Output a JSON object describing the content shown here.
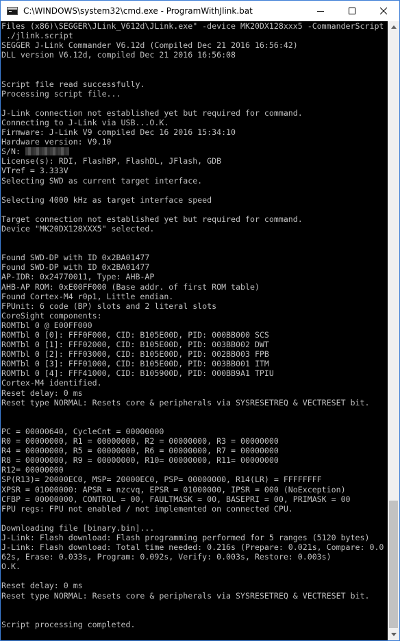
{
  "window": {
    "title": "C:\\WINDOWS\\system32\\cmd.exe - ProgramWithJlink.bat",
    "icon": "cmd-icon",
    "controls": {
      "minimize": "minimize-icon",
      "maximize": "maximize-icon",
      "close": "close-icon"
    }
  },
  "console": {
    "lines": [
      "Files (x86)\\SEGGER\\JLink_V612d\\JLink.exe\" -device MK20DX128xxx5 -CommanderScript",
      " ./jlink.script",
      "SEGGER J-Link Commander V6.12d (Compiled Dec 21 2016 16:56:42)",
      "DLL version V6.12d, compiled Dec 21 2016 16:56:08",
      "",
      "",
      "Script file read successfully.",
      "Processing script file...",
      "",
      "J-Link connection not established yet but required for command.",
      "Connecting to J-Link via USB...O.K.",
      "Firmware: J-Link V9 compiled Dec 16 2016 15:34:10",
      "Hardware version: V9.10",
      "S/N: ",
      "License(s): RDI, FlashBP, FlashDL, JFlash, GDB",
      "VTref = 3.333V",
      "Selecting SWD as current target interface.",
      "",
      "Selecting 4000 kHz as target interface speed",
      "",
      "Target connection not established yet but required for command.",
      "Device \"MK20DX128XXX5\" selected.",
      "",
      "",
      "Found SWD-DP with ID 0x2BA01477",
      "Found SWD-DP with ID 0x2BA01477",
      "AP-IDR: 0x24770011, Type: AHB-AP",
      "AHB-AP ROM: 0xE00FF000 (Base addr. of first ROM table)",
      "Found Cortex-M4 r0p1, Little endian.",
      "FPUnit: 6 code (BP) slots and 2 literal slots",
      "CoreSight components:",
      "ROMTbl 0 @ E00FF000",
      "ROMTbl 0 [0]: FFF0F000, CID: B105E00D, PID: 000BB000 SCS",
      "ROMTbl 0 [1]: FFF02000, CID: B105E00D, PID: 003BB002 DWT",
      "ROMTbl 0 [2]: FFF03000, CID: B105E00D, PID: 002BB003 FPB",
      "ROMTbl 0 [3]: FFF01000, CID: B105E00D, PID: 003BB001 ITM",
      "ROMTbl 0 [4]: FFF41000, CID: B105900D, PID: 000BB9A1 TPIU",
      "Cortex-M4 identified.",
      "Reset delay: 0 ms",
      "Reset type NORMAL: Resets core & peripherals via SYSRESETREQ & VECTRESET bit.",
      "",
      "",
      "PC = 00000640, CycleCnt = 00000000",
      "R0 = 00000000, R1 = 00000000, R2 = 00000000, R3 = 00000000",
      "R4 = 00000000, R5 = 00000000, R6 = 00000000, R7 = 00000000",
      "R8 = 00000000, R9 = 00000000, R10= 00000000, R11= 00000000",
      "R12= 00000000",
      "SP(R13)= 20000EC0, MSP= 20000EC0, PSP= 00000000, R14(LR) = FFFFFFFF",
      "XPSR = 01000000: APSR = nzcvq, EPSR = 01000000, IPSR = 000 (NoException)",
      "CFBP = 00000000, CONTROL = 00, FAULTMASK = 00, BASEPRI = 00, PRIMASK = 00",
      "FPU regs: FPU not enabled / not implemented on connected CPU.",
      "",
      "Downloading file [binary.bin]...",
      "J-Link: Flash download: Flash programming performed for 5 ranges (5120 bytes)",
      "J-Link: Flash download: Total time needed: 0.216s (Prepare: 0.021s, Compare: 0.0",
      "62s, Erase: 0.033s, Program: 0.092s, Verify: 0.003s, Restore: 0.003s)",
      "O.K.",
      "",
      "Reset delay: 0 ms",
      "Reset type NORMAL: Resets core & peripherals via SYSRESETREQ & VECTRESET bit.",
      "",
      "",
      "Script processing completed.",
      ""
    ],
    "redacted_line_index": 13
  }
}
